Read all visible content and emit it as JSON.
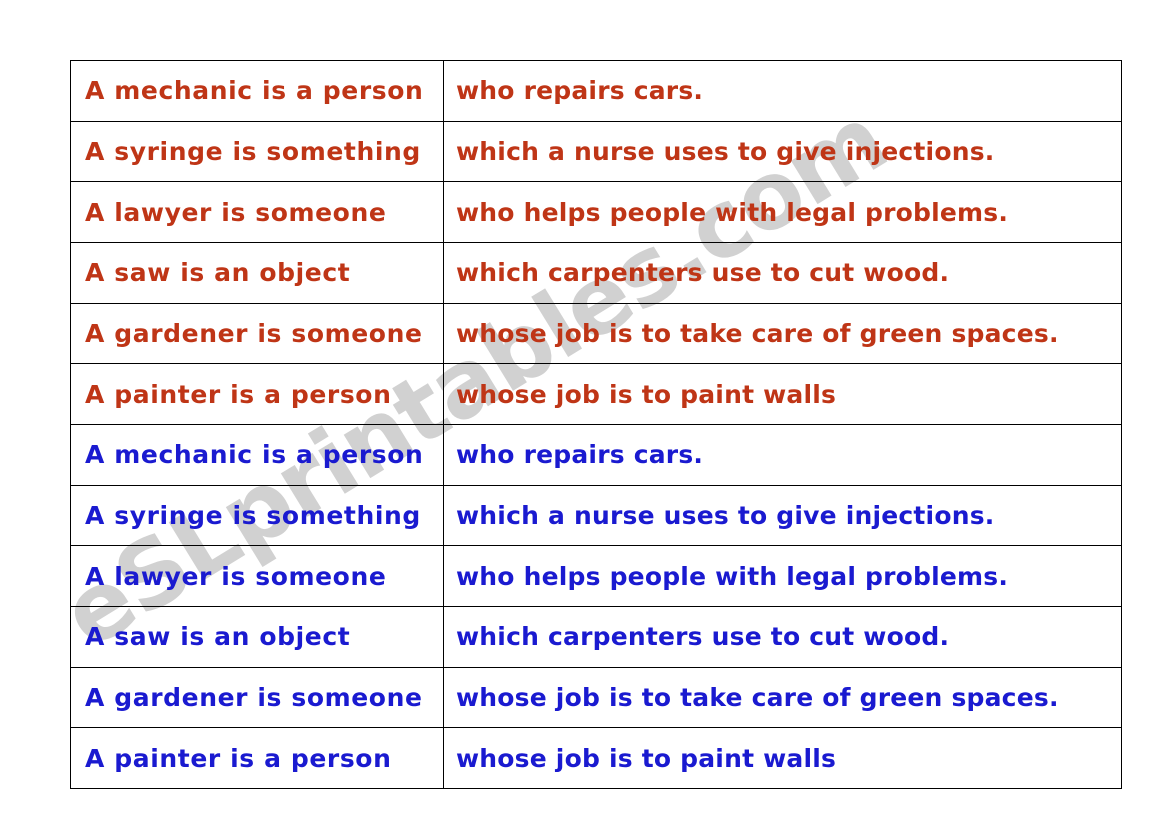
{
  "page": {
    "background_color": "#ffffff",
    "watermark": {
      "text": "eSLprintables.com",
      "color": "#c9c9c9"
    }
  },
  "colors": {
    "red_set": "#bf3516",
    "blue_set": "#1a1ad0",
    "border": "#000000"
  },
  "table": {
    "columns": [
      "subject",
      "clause"
    ],
    "rows": [
      {
        "set": "red",
        "subject": "A mechanic is a person",
        "clause": "who repairs cars."
      },
      {
        "set": "red",
        "subject": "A syringe is something",
        "clause": "which a nurse uses to give injections."
      },
      {
        "set": "red",
        "subject": "A lawyer is someone",
        "clause": "who helps people with legal problems."
      },
      {
        "set": "red",
        "subject": "A saw is an object",
        "clause": "which carpenters use to cut wood."
      },
      {
        "set": "red",
        "subject": "A gardener is someone",
        "clause": "whose job is to take care of green spaces."
      },
      {
        "set": "red",
        "subject": "A painter is a person",
        "clause": "whose job is to paint walls"
      },
      {
        "set": "blue",
        "subject": "A mechanic is a person",
        "clause": "who repairs cars."
      },
      {
        "set": "blue",
        "subject": "A syringe is something",
        "clause": "which a nurse uses to give injections."
      },
      {
        "set": "blue",
        "subject": "A lawyer is someone",
        "clause": "who helps people with legal problems."
      },
      {
        "set": "blue",
        "subject": "A saw is an object",
        "clause": "which carpenters use to cut wood."
      },
      {
        "set": "blue",
        "subject": "A gardener is someone",
        "clause": "whose job is to take care of green spaces."
      },
      {
        "set": "blue",
        "subject": "A painter is a person",
        "clause": "whose job is to paint walls"
      }
    ]
  }
}
